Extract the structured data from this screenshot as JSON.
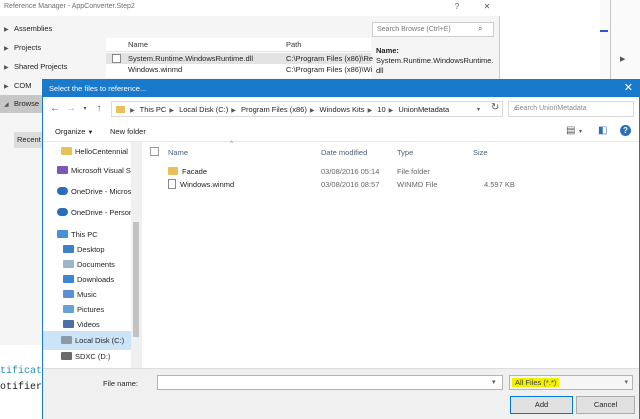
{
  "ref_manager": {
    "title": "Reference Manager - AppConverter.Step2",
    "nav": [
      "Assemblies",
      "Projects",
      "Shared Projects",
      "COM",
      "Browse",
      "Recent"
    ],
    "columns": [
      "Name",
      "Path"
    ],
    "rows": [
      {
        "name": "System.Runtime.WindowsRuntime.dll",
        "path": "C:\\Program Files (x86)\\Re"
      },
      {
        "name": "Windows.winmd",
        "path": "C:\\Program Files (x86)\\Wi"
      }
    ],
    "search_placeholder": "Search Browse (Ctrl+E)",
    "detail_label": "Name:",
    "detail_value": "System.Runtime.WindowsRuntime.dll"
  },
  "code_lines": [
    "tificati",
    "otifier("
  ],
  "dialog": {
    "title": "Select the files to reference...",
    "breadcrumb": [
      "This PC",
      "Local Disk (C:)",
      "Program Files (x86)",
      "Windows Kits",
      "10",
      "UnionMetadata"
    ],
    "search_placeholder": "Search UnionMetadata",
    "toolbar": {
      "organize": "Organize",
      "new_folder": "New folder"
    },
    "tree": [
      {
        "label": "HelloCentennial",
        "icon": "folder-icon"
      },
      {
        "label": "Microsoft Visual S",
        "icon": "vs-icon"
      },
      {
        "label": "OneDrive - Micros",
        "icon": "cloud-icon"
      },
      {
        "label": "OneDrive - Person",
        "icon": "cloud-icon"
      },
      {
        "label": "This PC",
        "icon": "computer-icon"
      },
      {
        "label": "Desktop",
        "icon": "desktop-icon"
      },
      {
        "label": "Documents",
        "icon": "documents-icon"
      },
      {
        "label": "Downloads",
        "icon": "downloads-icon"
      },
      {
        "label": "Music",
        "icon": "music-icon"
      },
      {
        "label": "Pictures",
        "icon": "pictures-icon"
      },
      {
        "label": "Videos",
        "icon": "videos-icon"
      },
      {
        "label": "Local Disk (C:)",
        "icon": "disk-icon"
      },
      {
        "label": "SDXC (D:)",
        "icon": "sd-card-icon"
      }
    ],
    "columns": [
      "Name",
      "Date modified",
      "Type",
      "Size"
    ],
    "files": [
      {
        "name": "Facade",
        "date": "03/08/2016 05:14",
        "type": "File folder",
        "size": ""
      },
      {
        "name": "Windows.winmd",
        "date": "03/08/2016 08:57",
        "type": "WINMD File",
        "size": "4.597 KB"
      }
    ],
    "file_name_label": "File name:",
    "file_name_value": "",
    "filter": "All Files (*.*)",
    "add": "Add",
    "cancel": "Cancel"
  }
}
